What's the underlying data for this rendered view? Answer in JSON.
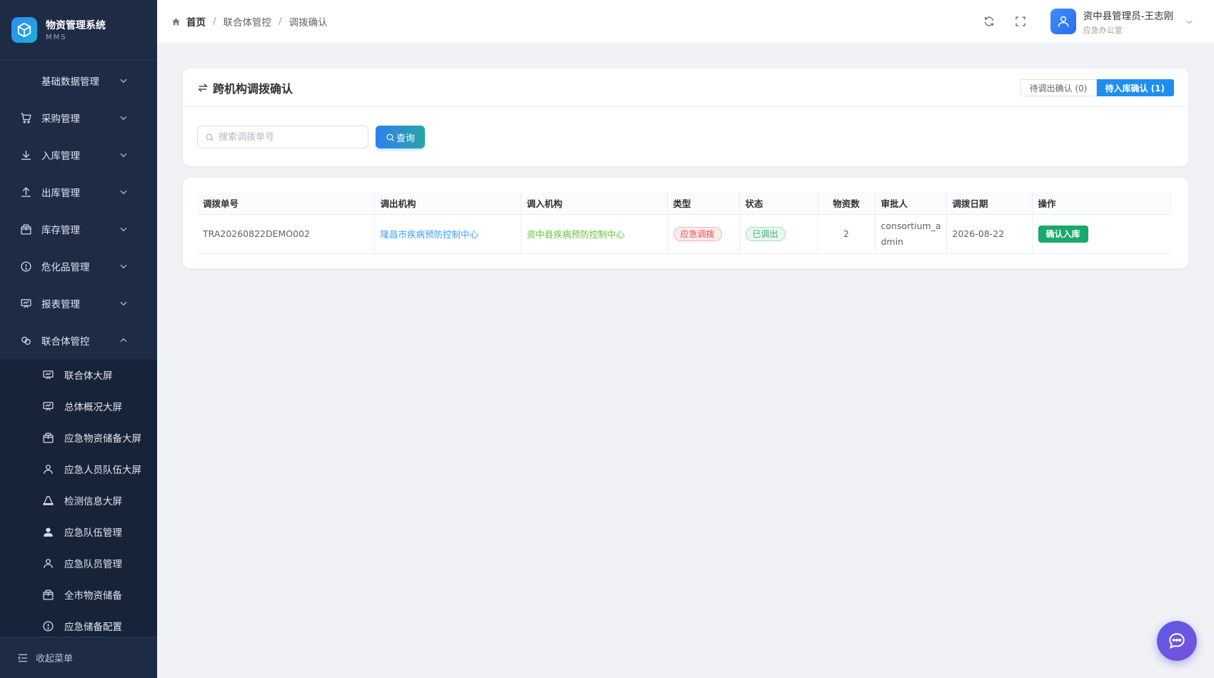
{
  "brand": {
    "title": "物资管理系统",
    "subtitle": "MMS",
    "accent": "#2f8af5"
  },
  "sidebar": {
    "items": [
      {
        "label": "基础数据管理",
        "icon": "none",
        "expanded": false
      },
      {
        "label": "采购管理",
        "icon": "cart-icon",
        "expanded": false
      },
      {
        "label": "入库管理",
        "icon": "download-icon",
        "expanded": false
      },
      {
        "label": "出库管理",
        "icon": "upload-icon",
        "expanded": false
      },
      {
        "label": "库存管理",
        "icon": "box-icon",
        "expanded": false
      },
      {
        "label": "危化品管理",
        "icon": "warning-circle-icon",
        "expanded": false
      },
      {
        "label": "报表管理",
        "icon": "presentation-icon",
        "expanded": false
      },
      {
        "label": "联合体管控",
        "icon": "link-icon",
        "expanded": true
      }
    ],
    "subitems": [
      {
        "label": "联合体大屏",
        "icon": "presentation-icon"
      },
      {
        "label": "总体概况大屏",
        "icon": "presentation-icon"
      },
      {
        "label": "应急物资储备大屏",
        "icon": "box-icon"
      },
      {
        "label": "应急人员队伍大屏",
        "icon": "user-icon"
      },
      {
        "label": "检测信息大屏",
        "icon": "flask-icon"
      },
      {
        "label": "应急队伍管理",
        "icon": "user-filled-icon"
      },
      {
        "label": "应急队员管理",
        "icon": "user-icon"
      },
      {
        "label": "全市物资储备",
        "icon": "box-icon"
      },
      {
        "label": "应急储备配置",
        "icon": "warning-circle-icon"
      }
    ],
    "collapse_label": "收起菜单",
    "bg_color": "#1d2b45"
  },
  "header": {
    "breadcrumb": [
      "首页",
      "联合体管控",
      "调拨确认"
    ],
    "user_name": "资中县管理员-王志刚",
    "user_dept": "应急办公室"
  },
  "page": {
    "title": "跨机构调拨确认",
    "tabs": [
      {
        "label": "待调出确认 (0)",
        "active": false
      },
      {
        "label": "待入库确认 (1)",
        "active": true
      }
    ],
    "search_placeholder": "搜索调拨单号",
    "search_value": "",
    "query_label": "查询"
  },
  "table": {
    "columns": [
      "调拨单号",
      "调出机构",
      "调入机构",
      "类型",
      "状态",
      "物资数",
      "审批人",
      "调拨日期",
      "操作"
    ],
    "rows": [
      {
        "no": "TRA20260822DEMO002",
        "from": "隆昌市疾病预防控制中心",
        "to": "资中县疾病预防控制中心",
        "type": "应急调拨",
        "status": "已调出",
        "count": "2",
        "approver": "consortium_admin",
        "date": "2026-08-22",
        "action": "确认入库"
      }
    ]
  },
  "colors": {
    "primary": "#1f8ef1",
    "confirm_green": "#1aa86b",
    "tag_red": "#f04b4b",
    "tag_green": "#3cb371"
  }
}
